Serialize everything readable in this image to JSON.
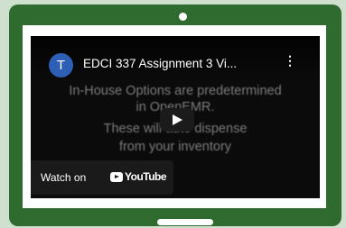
{
  "video": {
    "channel_initial": "T",
    "title": "EDCI 337 Assignment 3 Vi...",
    "menu_glyph": "⋮",
    "caption_lines": [
      "In-House Options are predetermined",
      "in OpenEMR.",
      "These will auto dispense",
      "from your inventory"
    ],
    "watch_on_label": "Watch on",
    "brand_wordmark": "YouTube"
  },
  "colors": {
    "device_frame": "#2f6b2e",
    "background": "#cfe0cf",
    "avatar": "#2c5fb5"
  }
}
